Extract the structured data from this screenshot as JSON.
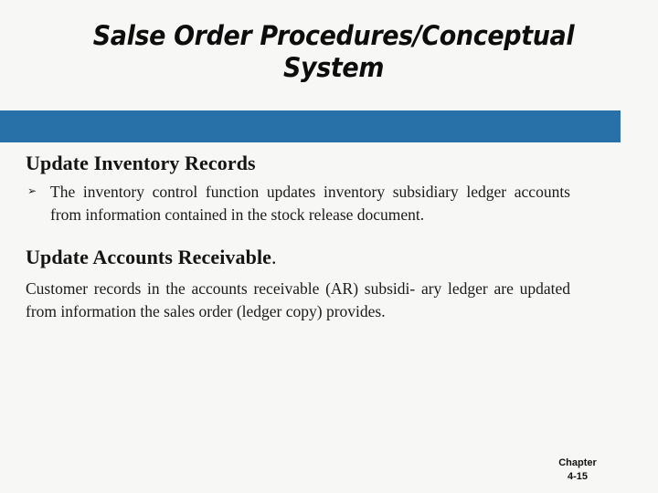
{
  "slide": {
    "title": "Salse Order Procedures/Conceptual System",
    "accent_color": "#2770a8",
    "background_color": "#f7f7f5",
    "text_color": "#1a1a1a"
  },
  "sections": [
    {
      "heading": "Update Inventory Records",
      "bullet_glyph": "➢",
      "bullets": [
        "The inventory control function updates inventory subsidiary ledger accounts from information contained in the stock release document."
      ]
    },
    {
      "heading": "Update Accounts Receivable",
      "heading_trailing": ".",
      "paragraph": "Customer records in the accounts receivable (AR) subsidi- ary ledger are updated from information the sales order (ledger copy) provides."
    }
  ],
  "footer": {
    "label": "Chapter",
    "page": "4-15"
  }
}
